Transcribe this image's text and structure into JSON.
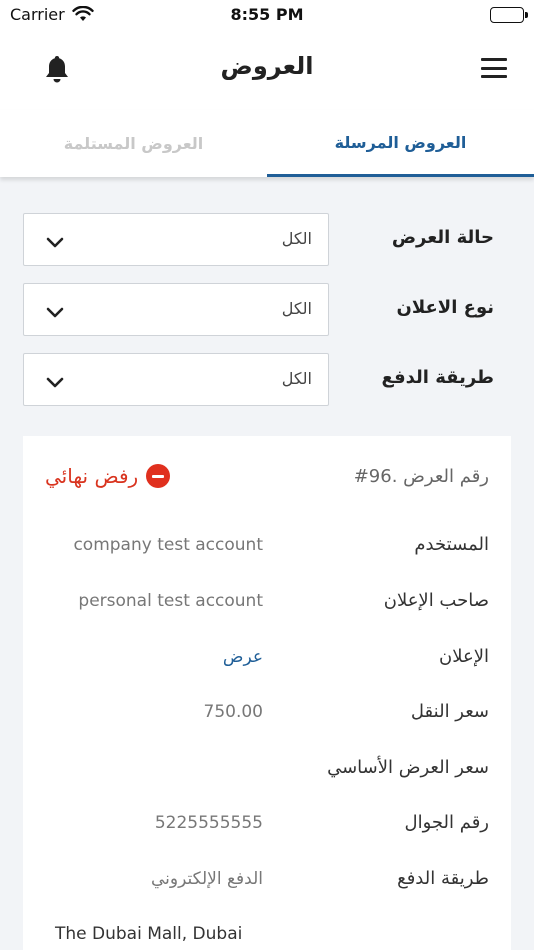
{
  "status_bar": {
    "carrier": "Carrier",
    "time": "8:55 PM",
    "icons": [
      "wifi-icon",
      "battery-icon"
    ]
  },
  "nav": {
    "title": "العروض",
    "icons": [
      "bell-icon",
      "hamburger-menu-icon"
    ]
  },
  "tabs": {
    "sent": "العروض المرسلة",
    "received": "العروض المستلمة",
    "active": "sent"
  },
  "filters": [
    {
      "label": "حالة العرض",
      "value": "الكل"
    },
    {
      "label": "نوع الاعلان",
      "value": "الكل"
    },
    {
      "label": "طريقة الدفع",
      "value": "الكل"
    }
  ],
  "offer": {
    "number_label": "رقم العرض .96#",
    "status_text": "رفض نهائي",
    "rows": [
      {
        "label": "المستخدم",
        "value": "company test account"
      },
      {
        "label": "صاحب الإعلان",
        "value": "personal test account"
      },
      {
        "label": "الإعلان",
        "value": "عرض"
      },
      {
        "label": "سعر النقل",
        "value": "750.00"
      },
      {
        "label": "سعر العرض الأساسي",
        "value": ""
      },
      {
        "label": "رقم الجوال",
        "value": "5225555555"
      },
      {
        "label": "طريقة الدفع",
        "value": "الدفع الإلكتروني"
      }
    ],
    "partial_text": "The Dubai Mall, Dubai"
  },
  "colors": {
    "accent": "#1f5e97",
    "danger": "#e0301e",
    "inactive_tab": "#c8c8c8",
    "background": "#f2f4f7"
  }
}
